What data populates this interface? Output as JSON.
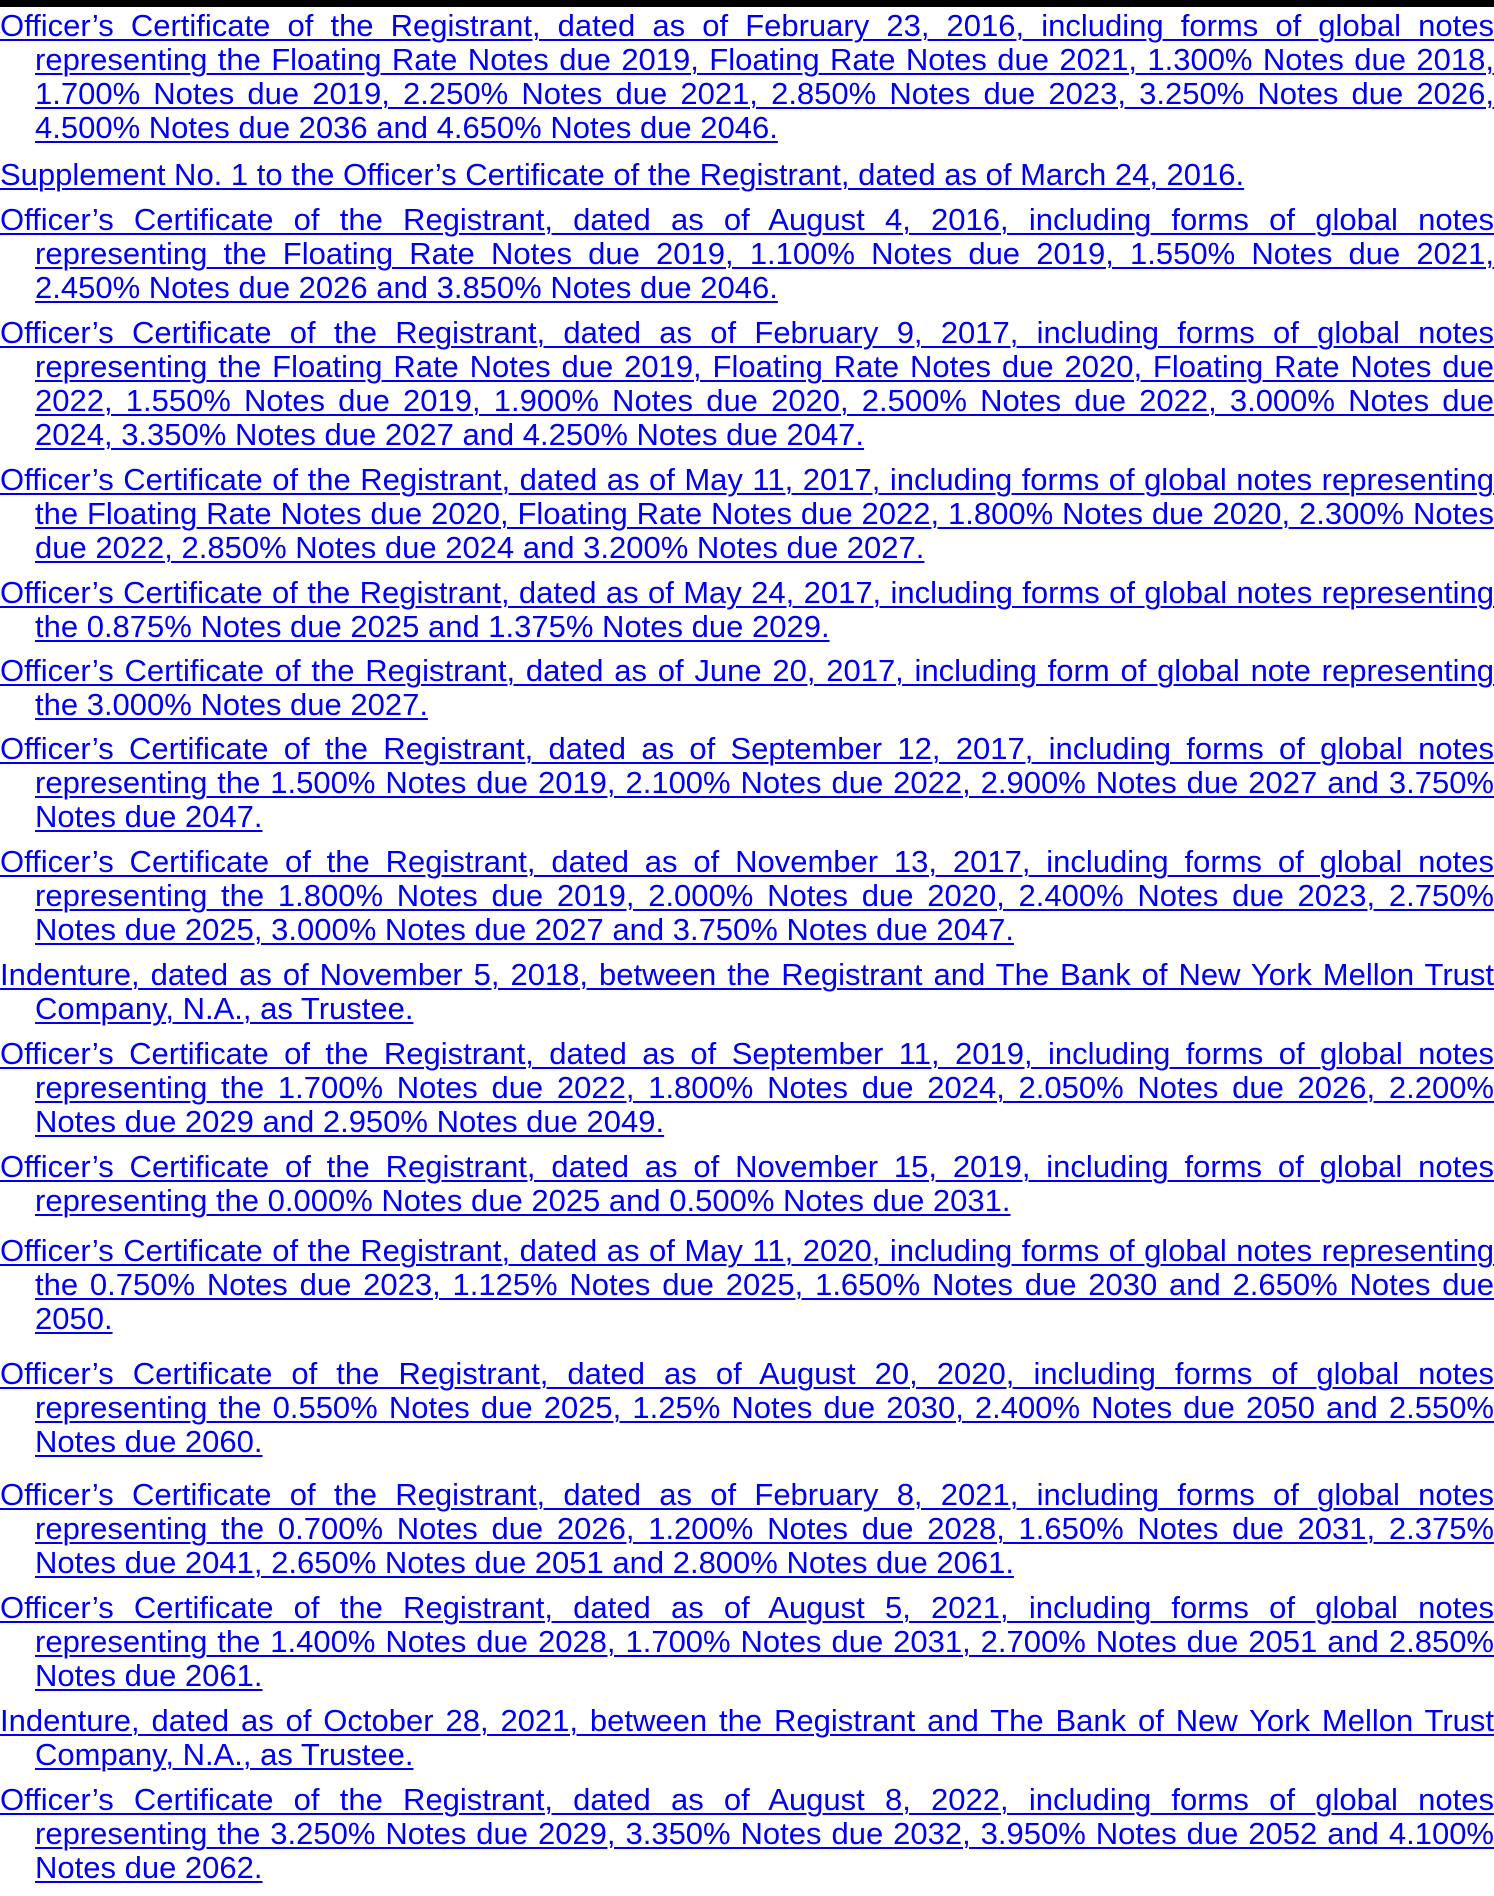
{
  "document": {
    "link_color": "#0000ee",
    "exhibits": [
      {
        "text": "Officer’s Certificate of the Registrant, dated as of February 23, 2016, including forms of global notes representing the Floating Rate Notes due 2019, Floating Rate Notes due 2021, 1.300% Notes due 2018, 1.700% Notes due 2019, 2.250% Notes due 2021, 2.850% Notes due 2023, 3.250% Notes due 2026, 4.500% Notes due 2036 and 4.650% Notes due 2046."
      },
      {
        "text": "Supplement No. 1 to the Officer’s Certificate of the Registrant, dated as of March 24, 2016."
      },
      {
        "text": "Officer’s Certificate of the Registrant, dated as of August 4, 2016, including forms of global notes representing the Floating Rate Notes due 2019, 1.100% Notes due 2019, 1.550% Notes due 2021, 2.450% Notes due 2026 and 3.850% Notes due 2046."
      },
      {
        "text": "Officer’s Certificate of the Registrant, dated as of February 9, 2017, including forms of global notes representing the Floating Rate Notes due 2019, Floating Rate Notes due 2020, Floating Rate Notes due 2022, 1.550% Notes due 2019, 1.900% Notes due 2020, 2.500% Notes due 2022, 3.000% Notes due 2024, 3.350% Notes due 2027 and 4.250% Notes due 2047."
      },
      {
        "text": "Officer’s Certificate of the Registrant, dated as of May 11, 2017, including forms of global notes representing the Floating Rate Notes due 2020, Floating Rate Notes due 2022, 1.800% Notes due 2020, 2.300% Notes due 2022, 2.850% Notes due 2024 and 3.200% Notes due 2027."
      },
      {
        "text": "Officer’s Certificate of the Registrant, dated as of May 24, 2017, including forms of global notes representing the 0.875% Notes due 2025 and 1.375% Notes due 2029."
      },
      {
        "text": "Officer’s Certificate of the Registrant, dated as of June 20, 2017, including form of global note representing the 3.000% Notes due 2027."
      },
      {
        "text": "Officer’s Certificate of the Registrant, dated as of September 12, 2017, including forms of global notes representing the 1.500% Notes due 2019, 2.100% Notes due 2022, 2.900% Notes due 2027 and 3.750% Notes due 2047."
      },
      {
        "text": "Officer’s Certificate of the Registrant, dated as of November 13, 2017, including forms of global notes representing the 1.800% Notes due 2019, 2.000% Notes due 2020, 2.400% Notes due 2023, 2.750% Notes due 2025, 3.000% Notes due 2027 and 3.750% Notes due 2047."
      },
      {
        "text": "Indenture, dated as of November 5, 2018, between the Registrant and The Bank of New York Mellon Trust Company, N.A., as Trustee."
      },
      {
        "text": "Officer’s Certificate of the Registrant, dated as of September 11, 2019, including forms of global notes representing the 1.700% Notes due 2022, 1.800% Notes due 2024, 2.050% Notes due 2026, 2.200% Notes due 2029 and 2.950% Notes due 2049."
      },
      {
        "text": "Officer’s Certificate of the Registrant, dated as of November 15, 2019, including forms of global notes representing the 0.000% Notes due 2025 and 0.500% Notes due 2031."
      },
      {
        "text": "Officer’s Certificate of the Registrant, dated as of May 11, 2020, including forms of global notes representing the 0.750% Notes due 2023, 1.125% Notes due 2025, 1.650% Notes due 2030 and 2.650% Notes due 2050."
      },
      {
        "text": "Officer’s Certificate of the Registrant, dated as of August 20, 2020, including forms of global notes representing the 0.550% Notes due 2025, 1.25% Notes due 2030, 2.400% Notes due 2050 and 2.550% Notes due 2060."
      },
      {
        "text": "Officer’s Certificate of the Registrant, dated as of February 8, 2021, including forms of global notes representing the 0.700% Notes due 2026, 1.200% Notes due 2028, 1.650% Notes due 2031, 2.375% Notes due 2041, 2.650% Notes due 2051 and 2.800% Notes due 2061."
      },
      {
        "text": "Officer’s Certificate of the Registrant, dated as of August 5, 2021, including forms of global notes representing the 1.400% Notes due 2028, 1.700% Notes due 2031, 2.700% Notes due 2051 and 2.850% Notes due 2061."
      },
      {
        "text": "Indenture, dated as of October 28, 2021, between the Registrant and The Bank of New York Mellon Trust Company, N.A., as Trustee."
      },
      {
        "text": "Officer’s Certificate of the Registrant, dated as of August 8, 2022, including forms of global notes representing the 3.250% Notes due 2029, 3.350% Notes due 2032, 3.950% Notes due 2052 and 4.100% Notes due 2062."
      }
    ]
  }
}
